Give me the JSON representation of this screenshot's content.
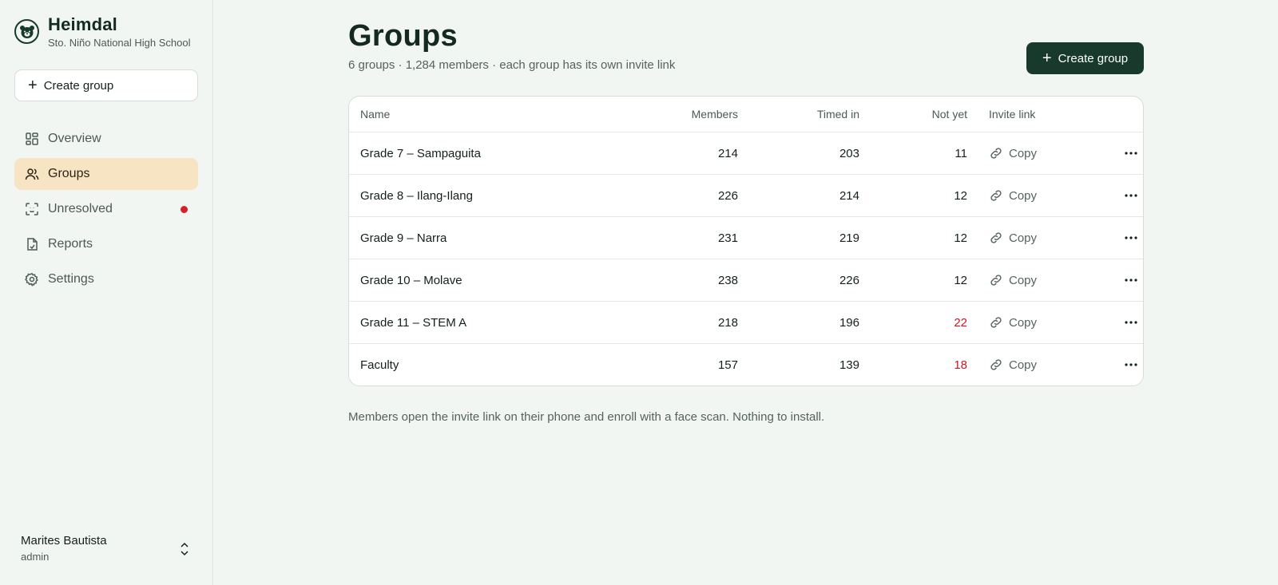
{
  "brand": {
    "name": "Heimdal",
    "school": "Sto. Niño National High School"
  },
  "sidebar": {
    "create_label": "Create group",
    "items": [
      {
        "label": "Overview",
        "icon": "dashboard-icon"
      },
      {
        "label": "Groups",
        "icon": "users-icon",
        "active": true
      },
      {
        "label": "Unresolved",
        "icon": "face-scan-icon",
        "badge": "red-dot"
      },
      {
        "label": "Reports",
        "icon": "report-file-icon"
      },
      {
        "label": "Settings",
        "icon": "gear-icon"
      }
    ]
  },
  "user": {
    "name": "Marites Bautista",
    "role": "admin"
  },
  "header": {
    "title": "Groups",
    "subtitle": "6 groups · 1,284 members · each group has its own invite link",
    "create_label": "Create group"
  },
  "table": {
    "columns": {
      "name": "Name",
      "members": "Members",
      "timed_in": "Timed in",
      "not_yet": "Not yet",
      "invite": "Invite link"
    },
    "copy_label": "Copy",
    "rows": [
      {
        "name": "Grade 7 – Sampaguita",
        "members": "214",
        "timed_in": "203",
        "not_yet": "11"
      },
      {
        "name": "Grade 8 – Ilang-Ilang",
        "members": "226",
        "timed_in": "214",
        "not_yet": "12"
      },
      {
        "name": "Grade 9 – Narra",
        "members": "231",
        "timed_in": "219",
        "not_yet": "12"
      },
      {
        "name": "Grade 10 – Molave",
        "members": "238",
        "timed_in": "226",
        "not_yet": "12"
      },
      {
        "name": "Grade 11 – STEM A",
        "members": "218",
        "timed_in": "196",
        "not_yet": "22",
        "not_yet_alert": true
      },
      {
        "name": "Faculty",
        "members": "157",
        "timed_in": "139",
        "not_yet": "18",
        "not_yet_alert": true
      }
    ]
  },
  "footnote": "Members open the invite link on their phone and enroll with a face scan. Nothing to install.",
  "colors": {
    "accent": "#183a2d",
    "active_nav": "#f6e4c3",
    "alert": "#c61b24",
    "background": "#f1f6f2"
  }
}
